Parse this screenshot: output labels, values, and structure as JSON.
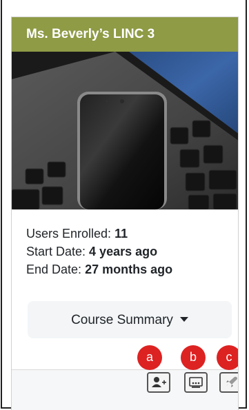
{
  "card": {
    "title": "Ms. Beverly’s LINC 3",
    "users_enrolled_label": "Users Enrolled: ",
    "users_enrolled_value": "11",
    "start_date_label": "Start Date: ",
    "start_date_value": "4 years ago",
    "end_date_label": "End Date: ",
    "end_date_value": "27 months ago",
    "summary_button": "Course Summary"
  },
  "markers": {
    "a": "a",
    "b": "b",
    "c": "c"
  },
  "icons": [
    "add-user-icon",
    "presentation-icon",
    "rocket-icon"
  ],
  "colors": {
    "header": "#8f9b45",
    "marker": "#dd2222"
  }
}
